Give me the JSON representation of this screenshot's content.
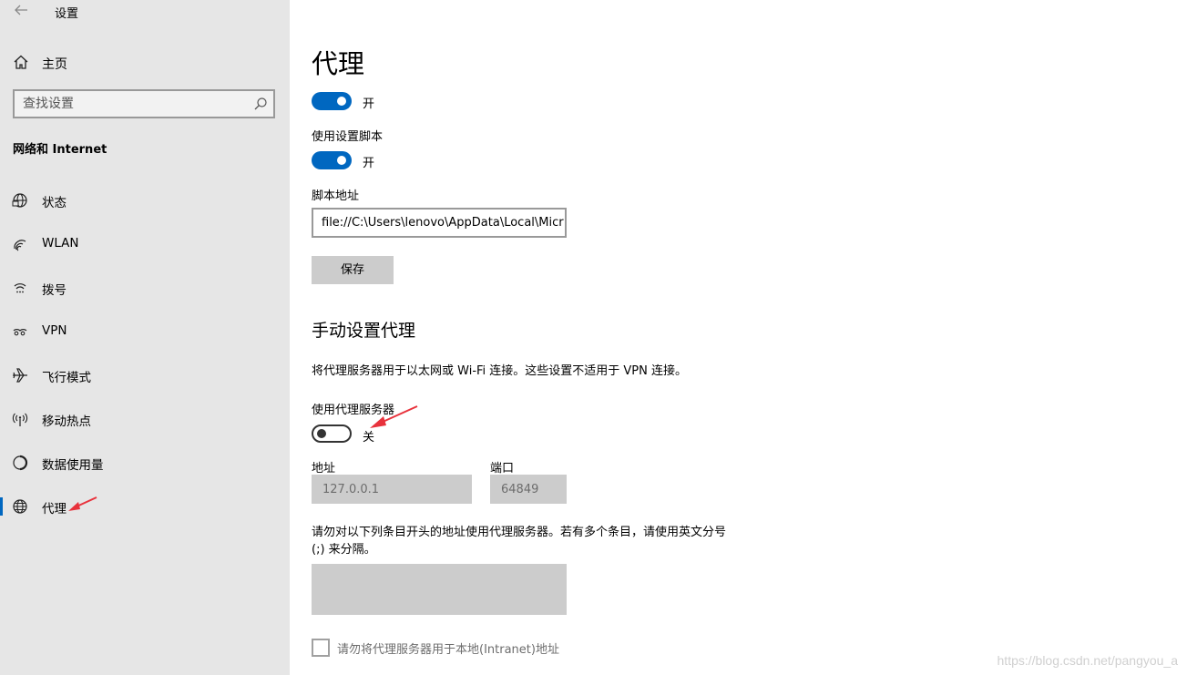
{
  "window": {
    "title": "设置"
  },
  "sidebar": {
    "home_label": "主页",
    "search_placeholder": "查找设置",
    "section_title": "网络和 Internet",
    "items": [
      {
        "label": "状态",
        "icon": "globe-status-icon"
      },
      {
        "label": "WLAN",
        "icon": "wifi-icon"
      },
      {
        "label": "拨号",
        "icon": "dialup-icon"
      },
      {
        "label": "VPN",
        "icon": "vpn-icon"
      },
      {
        "label": "飞行模式",
        "icon": "airplane-icon"
      },
      {
        "label": "移动热点",
        "icon": "hotspot-icon"
      },
      {
        "label": "数据使用量",
        "icon": "data-usage-icon"
      },
      {
        "label": "代理",
        "icon": "globe-icon",
        "selected": true
      }
    ]
  },
  "main": {
    "title": "代理",
    "auto_detect": {
      "state": "开",
      "on": true
    },
    "use_script": {
      "label": "使用设置脚本",
      "state": "开",
      "on": true
    },
    "script_address": {
      "label": "脚本地址",
      "value": "file://C:\\Users\\lenovo\\AppData\\Local\\Micr"
    },
    "save_label": "保存",
    "manual_title": "手动设置代理",
    "manual_desc": "将代理服务器用于以太网或 Wi-Fi 连接。这些设置不适用于 VPN 连接。",
    "use_proxy": {
      "label": "使用代理服务器",
      "state": "关",
      "on": false
    },
    "address": {
      "label": "地址",
      "value": "127.0.0.1"
    },
    "port": {
      "label": "端口",
      "value": "64849"
    },
    "exceptions_text": "请勿对以下列条目开头的地址使用代理服务器。若有多个条目，请使用英文分号 (;) 来分隔。",
    "exceptions_value": "",
    "local_checkbox_label": "请勿将代理服务器用于本地(Intranet)地址",
    "local_checked": false
  },
  "annotation_color": "#e8323c",
  "accent_color": "#0067c0",
  "watermark": "https://blog.csdn.net/pangyou_a"
}
